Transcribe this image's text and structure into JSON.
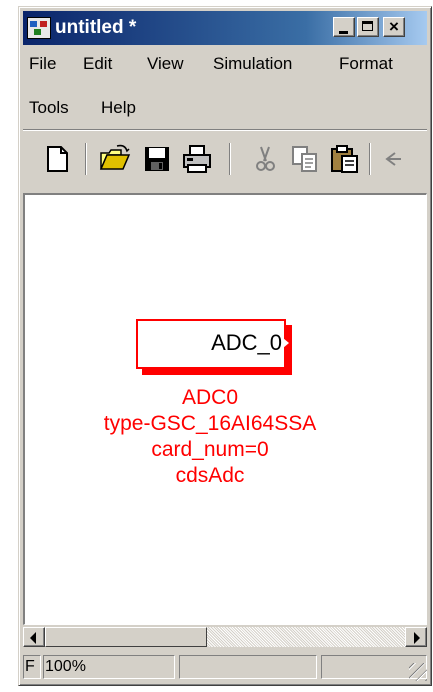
{
  "window": {
    "title": "untitled *",
    "close_label": "×"
  },
  "menu": {
    "row1": [
      "File",
      "Edit",
      "View",
      "Simulation",
      "Format"
    ],
    "row2": [
      "Tools",
      "Help"
    ]
  },
  "toolbar": {
    "icons": [
      "new-icon",
      "open-icon",
      "save-icon",
      "print-icon",
      "cut-icon",
      "copy-icon",
      "paste-icon",
      "undo-icon"
    ]
  },
  "block": {
    "port_label": "ADC_0",
    "name": "ADC0",
    "type": "type-GSC_16AI64SSA",
    "card_num": "card_num=0",
    "library": "cdsAdc",
    "color": "#ff0000"
  },
  "status": {
    "left": "F",
    "zoom": "100%"
  }
}
